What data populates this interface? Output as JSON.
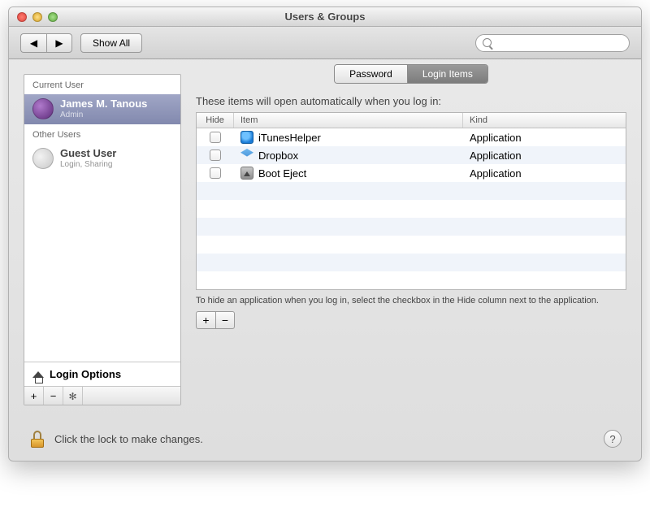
{
  "window": {
    "title": "Users & Groups"
  },
  "toolbar": {
    "show_all": "Show All",
    "search_placeholder": ""
  },
  "sidebar": {
    "current_header": "Current User",
    "other_header": "Other Users",
    "login_options": "Login Options",
    "current": {
      "name": "James M. Tanous",
      "role": "Admin"
    },
    "others": [
      {
        "name": "Guest User",
        "role": "Login, Sharing"
      }
    ]
  },
  "tabs": {
    "password": "Password",
    "login_items": "Login Items",
    "active": "login_items"
  },
  "main": {
    "instruction": "These items will open automatically when you log in:",
    "cols": {
      "hide": "Hide",
      "item": "Item",
      "kind": "Kind"
    },
    "rows": [
      {
        "name": "iTunesHelper",
        "kind": "Application",
        "icon": "itunes",
        "hide": false
      },
      {
        "name": "Dropbox",
        "kind": "Application",
        "icon": "dropbox",
        "hide": false
      },
      {
        "name": "Boot Eject",
        "kind": "Application",
        "icon": "booteject",
        "hide": false
      }
    ],
    "hint": "To hide an application when you log in, select the checkbox in the Hide column next to the application."
  },
  "footer": {
    "lock_msg": "Click the lock to make changes."
  }
}
